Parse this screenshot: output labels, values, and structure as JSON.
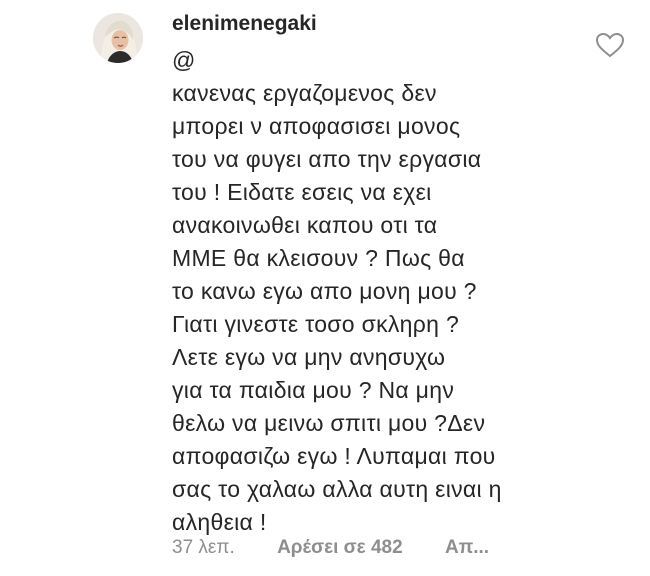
{
  "comment": {
    "username": "elenimenegaki",
    "mention": "@",
    "lines": [
      "κανενας εργαζομενος δεν",
      "μπορει ν αποφασισει μονος",
      "του να φυγει απο την εργασια",
      "του ! Ειδατε εσεις να εχει",
      "ανακοινωθει καπου οτι τα",
      "ΜΜΕ θα κλεισουν ? Πως θα",
      "το κανω εγω απο μονη μου ?",
      "Γιατι γινεστε τοσο σκληρη ?",
      "Λετε εγω να μην ανησυχω",
      "για τα παιδια μου ? Να μην",
      "θελω να μεινω σπιτι μου ?Δεν",
      "αποφασιζω εγω ! Λυπαμαι που",
      "σας το χαλαω αλλα αυτη ειναι η",
      "αληθεια !"
    ],
    "timestamp": "37 λεπ.",
    "likes": "Αρέσει σε 482",
    "reply": "Απ..."
  },
  "icons": {
    "like": "heart-outline-icon",
    "avatar": "profile-avatar"
  },
  "colors": {
    "text": "#262626",
    "secondary": "#8e8e8e",
    "background": "#ffffff"
  }
}
